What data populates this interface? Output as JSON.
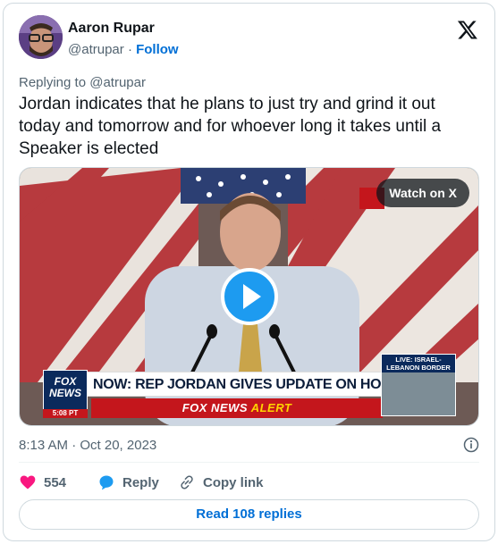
{
  "author": {
    "name": "Aaron Rupar",
    "handle": "@atrupar",
    "separator": "·",
    "follow_label": "Follow"
  },
  "reply_to": "Replying to @atrupar",
  "tweet_text": "Jordan indicates that he plans to just try and grind it out today and tomorrow and for whoever long it takes until a Speaker is elected",
  "media": {
    "watch_label": "Watch on X",
    "chyron": "NOW: REP JORDAN GIVES UPDATE ON HOUSE SPEAKER VOTE",
    "alert_brand": "FOX NEWS",
    "alert_word": "ALERT",
    "fox_logo_top": "FOX",
    "fox_logo_bottom": "NEWS",
    "fox_time": "5:08 PT",
    "live_label": "LIVE: ISRAEL-LEBANON BORDER"
  },
  "timestamp": "8:13 AM · Oct 20, 2023",
  "actions": {
    "likes": "554",
    "reply_label": "Reply",
    "copy_link_label": "Copy link"
  },
  "read_replies_label": "Read 108 replies",
  "colors": {
    "link_blue": "#006fd6",
    "play_blue": "#1d9bf0",
    "like_pink": "#f91880",
    "muted": "#536471"
  },
  "icons": [
    "x-logo-icon",
    "play-icon",
    "info-icon",
    "heart-icon",
    "reply-icon",
    "link-icon"
  ]
}
